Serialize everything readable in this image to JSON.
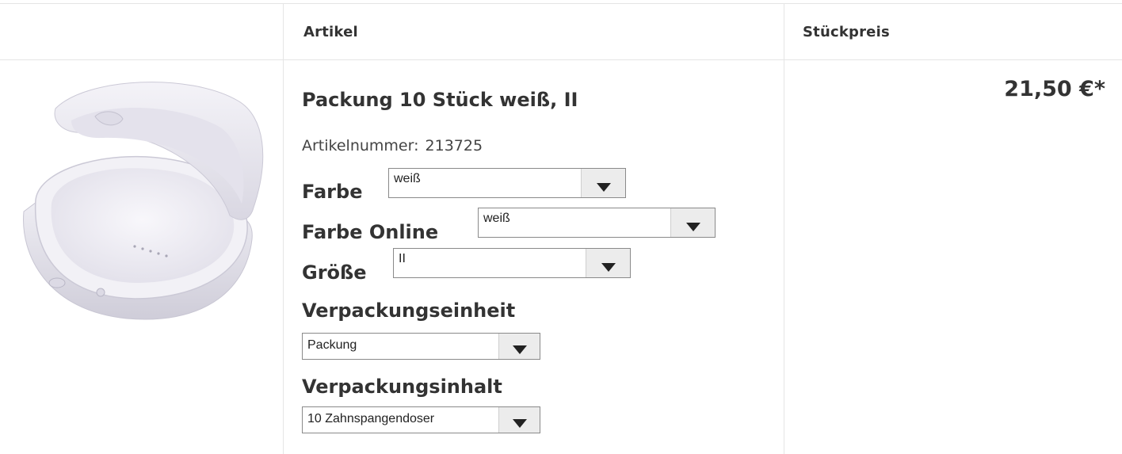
{
  "header": {
    "article": "Artikel",
    "unit_price": "Stückpreis"
  },
  "product": {
    "image_alt": "Zahnspangendose weiß",
    "title": "Packung 10 Stück weiß, II",
    "article_number_label": "Artikelnummer:",
    "article_number": "213725",
    "price": "21,50 €*"
  },
  "options": {
    "color_label": "Farbe",
    "color_value": "weiß",
    "color_online_label": "Farbe Online",
    "color_online_value": "weiß",
    "size_label": "Größe",
    "size_value": "II",
    "packaging_unit_label": "Verpackungseinheit",
    "packaging_unit_value": "Packung",
    "packaging_content_label": "Verpackungsinhalt",
    "packaging_content_value": "10 Zahnspangendoser"
  },
  "colors": {
    "border": "#e5e5e5",
    "text": "#333333",
    "select_border": "#8a8a8a",
    "select_button": "#ececec"
  }
}
